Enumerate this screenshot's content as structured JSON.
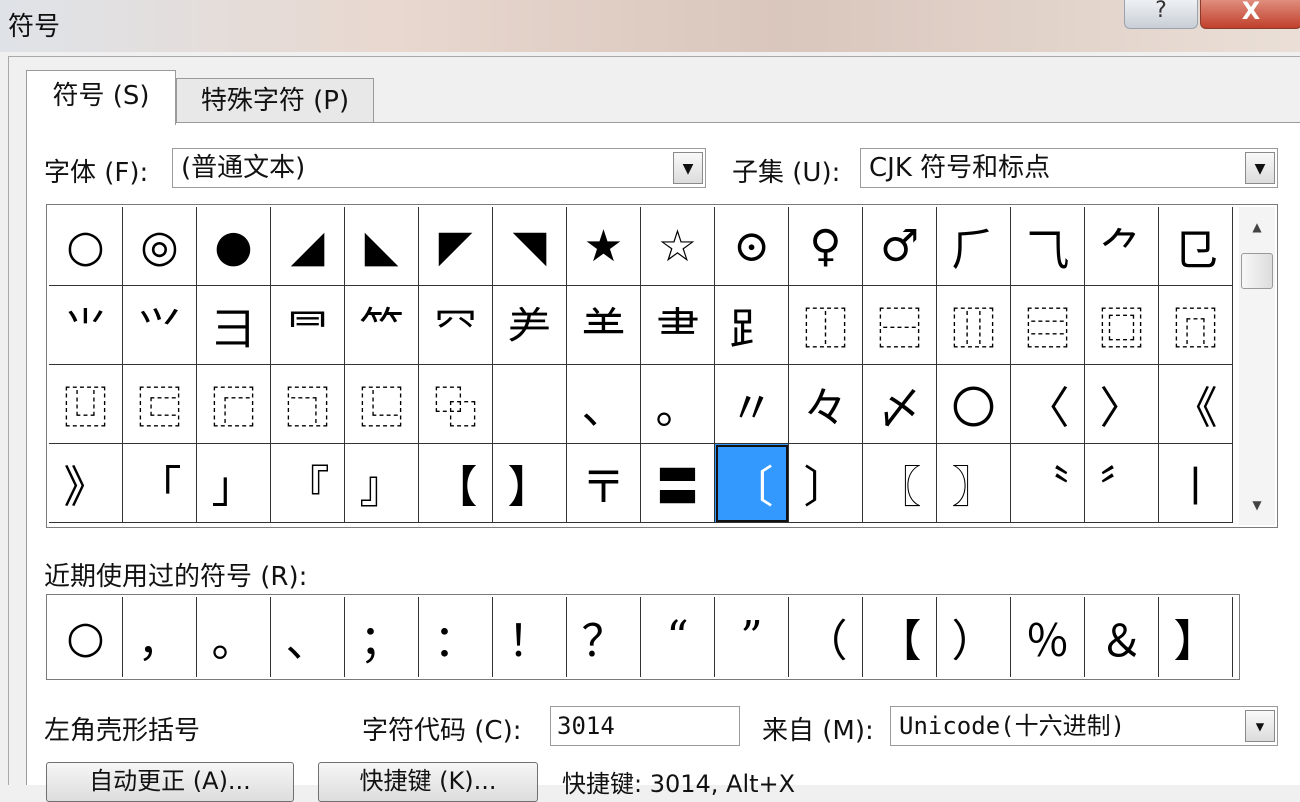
{
  "window": {
    "title": "符号",
    "help_label": "?",
    "close_label": "X"
  },
  "tabs": [
    {
      "label": "符号 (S)"
    },
    {
      "label": "特殊字符 (P)"
    }
  ],
  "font": {
    "label": "字体 (F):",
    "value": "(普通文本)"
  },
  "subset": {
    "label": "子集 (U):",
    "value": "CJK 符号和标点"
  },
  "symbol_grid": {
    "rows": [
      [
        "○",
        "◎",
        "●",
        "◢",
        "◣",
        "◤",
        "◥",
        "★",
        "☆",
        "⊙",
        "♀",
        "♂",
        "⺁",
        "⺄",
        "⺈",
        "⺋"
      ],
      [
        "⺌",
        "⺍",
        "⺕",
        "⺜",
        "⺮",
        "⺳",
        "⺶",
        "⺷",
        "⺻",
        "⻊",
        "⿰",
        "⿱",
        "⿲",
        "⿳",
        "⿴",
        "⿵"
      ],
      [
        "⿶",
        "⿷",
        "⿸",
        "⿹",
        "⿺",
        "⿻",
        "",
        "、",
        "。",
        "〃",
        "々",
        "〆",
        "〇",
        "〈",
        "〉",
        "《"
      ],
      [
        "》",
        "「",
        "」",
        "『",
        "』",
        "【",
        "】",
        "〒",
        "〓",
        "〔",
        "〕",
        "〖",
        "〗",
        "〝",
        "〞",
        "〡"
      ]
    ],
    "selected": {
      "row": 3,
      "col": 9
    }
  },
  "recent": {
    "label": "近期使用过的符号 (R):",
    "symbols": [
      "○",
      "，",
      "。",
      "、",
      "；",
      "：",
      "！",
      "？",
      "“",
      "”",
      "（",
      "【",
      "）",
      "％",
      "＆",
      "】"
    ]
  },
  "char_name": "左角壳形括号",
  "char_code": {
    "label": "字符代码 (C):",
    "value": "3014"
  },
  "from": {
    "label": "来自 (M):",
    "value": "Unicode(十六进制)"
  },
  "buttons": {
    "autocorrect": "自动更正 (A)...",
    "shortcut_key": "快捷键 (K)..."
  },
  "shortcut_text": "快捷键: 3014, Alt+X",
  "colors": {
    "selected_cell": "#3399ff",
    "close_button": "#c0402c"
  }
}
